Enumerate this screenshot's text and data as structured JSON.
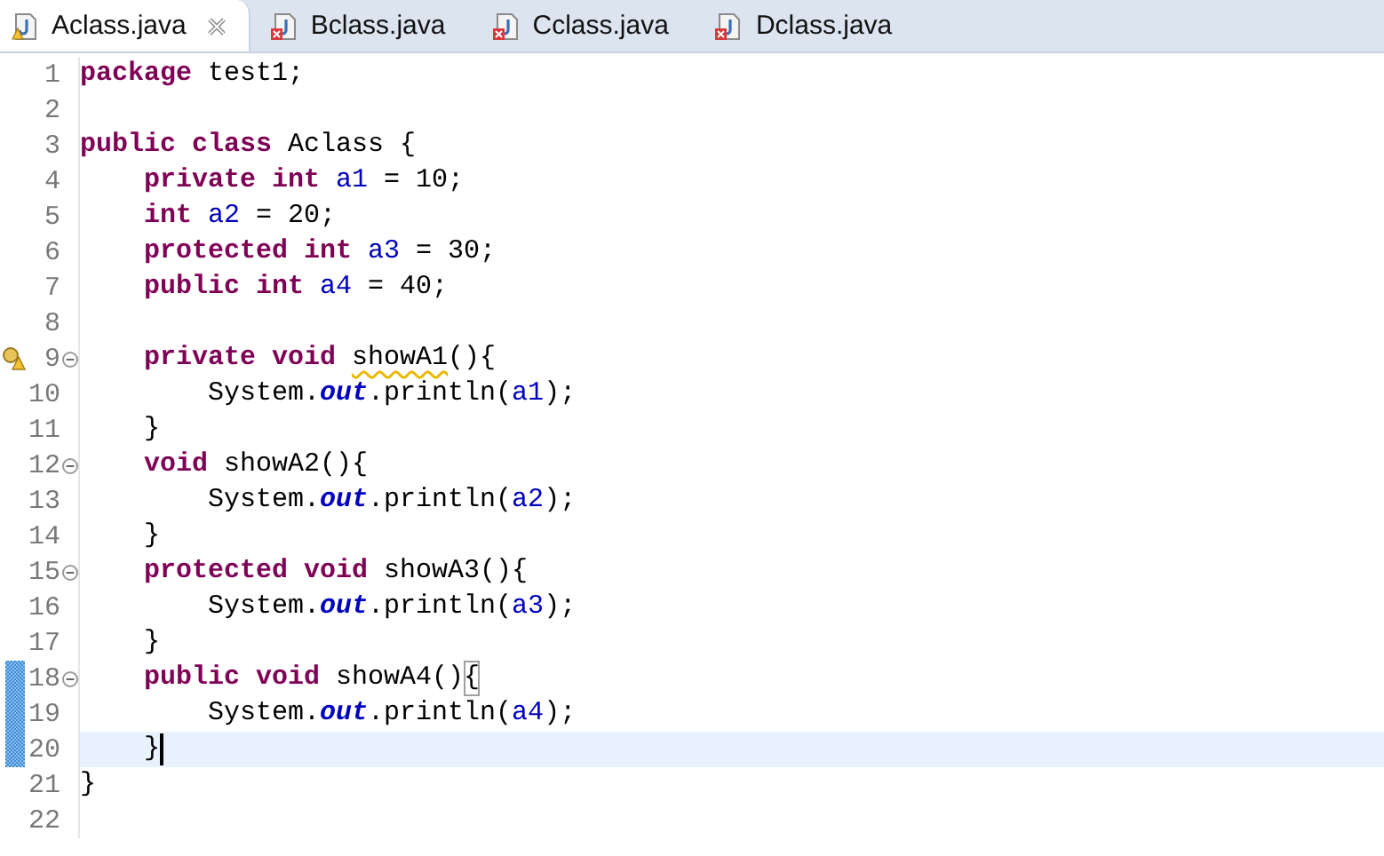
{
  "tabs": [
    {
      "label": "Aclass.java",
      "selected": true,
      "kind": "warning"
    },
    {
      "label": "Bclass.java",
      "selected": false,
      "kind": "error"
    },
    {
      "label": "Cclass.java",
      "selected": false,
      "kind": "error"
    },
    {
      "label": "Dclass.java",
      "selected": false,
      "kind": "error"
    }
  ],
  "editor": {
    "lines": [
      {
        "number": "1",
        "tokens": [
          {
            "kind": "keyword",
            "text": "package "
          },
          {
            "kind": "plain",
            "text": "test1;"
          }
        ]
      },
      {
        "number": "2"
      },
      {
        "number": "3",
        "tokens": [
          {
            "kind": "keyword",
            "text": "public class "
          },
          {
            "kind": "plain",
            "text": "Aclass {"
          }
        ],
        "children": [
          {
            "number": "4",
            "tokens": [
              {
                "kind": "keyword",
                "text": "private int "
              },
              {
                "kind": "field",
                "text": "a1"
              },
              {
                "kind": "plain",
                "text": " = 10;"
              }
            ]
          },
          {
            "number": "5",
            "tokens": [
              {
                "kind": "keyword",
                "text": "int "
              },
              {
                "kind": "field",
                "text": "a2"
              },
              {
                "kind": "plain",
                "text": " = 20;"
              }
            ]
          },
          {
            "number": "6",
            "tokens": [
              {
                "kind": "keyword",
                "text": "protected int "
              },
              {
                "kind": "field",
                "text": "a3"
              },
              {
                "kind": "plain",
                "text": " = 30;"
              }
            ]
          },
          {
            "number": "7",
            "tokens": [
              {
                "kind": "keyword",
                "text": "public int "
              },
              {
                "kind": "field",
                "text": "a4"
              },
              {
                "kind": "plain",
                "text": " = 40;"
              }
            ]
          },
          {
            "number": "8"
          },
          {
            "number": "9",
            "fold": true,
            "warning": true,
            "tokens": [
              {
                "kind": "keyword",
                "text": "private void "
              },
              {
                "kind": "warned",
                "text": "showA1"
              },
              {
                "kind": "plain",
                "text": "(){"
              }
            ],
            "children": [
              {
                "number": "10",
                "tokens": [
                  {
                    "kind": "plain",
                    "text": "System."
                  },
                  {
                    "kind": "static",
                    "text": "out"
                  },
                  {
                    "kind": "plain",
                    "text": ".println("
                  },
                  {
                    "kind": "field",
                    "text": "a1"
                  },
                  {
                    "kind": "plain",
                    "text": ");"
                  }
                ]
              }
            ]
          },
          {
            "number": "11",
            "tokens": [
              {
                "kind": "plain",
                "text": "}"
              }
            ]
          },
          {
            "number": "12",
            "fold": true,
            "tokens": [
              {
                "kind": "keyword",
                "text": "void "
              },
              {
                "kind": "plain",
                "text": "showA2(){"
              }
            ],
            "children": [
              {
                "number": "13",
                "tokens": [
                  {
                    "kind": "plain",
                    "text": "System."
                  },
                  {
                    "kind": "static",
                    "text": "out"
                  },
                  {
                    "kind": "plain",
                    "text": ".println("
                  },
                  {
                    "kind": "field",
                    "text": "a2"
                  },
                  {
                    "kind": "plain",
                    "text": ");"
                  }
                ]
              }
            ]
          },
          {
            "number": "14",
            "tokens": [
              {
                "kind": "plain",
                "text": "}"
              }
            ]
          },
          {
            "number": "15",
            "fold": true,
            "tokens": [
              {
                "kind": "keyword",
                "text": "protected void "
              },
              {
                "kind": "plain",
                "text": "showA3(){"
              }
            ],
            "children": [
              {
                "number": "16",
                "tokens": [
                  {
                    "kind": "plain",
                    "text": "System."
                  },
                  {
                    "kind": "static",
                    "text": "out"
                  },
                  {
                    "kind": "plain",
                    "text": ".println("
                  },
                  {
                    "kind": "field",
                    "text": "a3"
                  },
                  {
                    "kind": "plain",
                    "text": ");"
                  }
                ]
              }
            ]
          },
          {
            "number": "17",
            "tokens": [
              {
                "kind": "plain",
                "text": "}"
              }
            ]
          },
          {
            "number": "18",
            "fold": true,
            "changed": true,
            "tokens": [
              {
                "kind": "keyword",
                "text": "public void "
              },
              {
                "kind": "plain",
                "text": "showA4()"
              },
              {
                "kind": "bracket",
                "text": "{"
              }
            ],
            "children": [
              {
                "number": "19",
                "changed": true,
                "tokens": [
                  {
                    "kind": "plain",
                    "text": "System."
                  },
                  {
                    "kind": "static",
                    "text": "out"
                  },
                  {
                    "kind": "plain",
                    "text": ".println("
                  },
                  {
                    "kind": "field",
                    "text": "a4"
                  },
                  {
                    "kind": "plain",
                    "text": ");"
                  }
                ]
              }
            ]
          },
          {
            "number": "20",
            "changed": true,
            "current": true,
            "caret": true,
            "tokens": [
              {
                "kind": "plain",
                "text": "}"
              }
            ]
          }
        ]
      },
      {
        "number": "21",
        "tokens": [
          {
            "kind": "plain",
            "text": "}"
          }
        ]
      },
      {
        "number": "22"
      }
    ]
  }
}
